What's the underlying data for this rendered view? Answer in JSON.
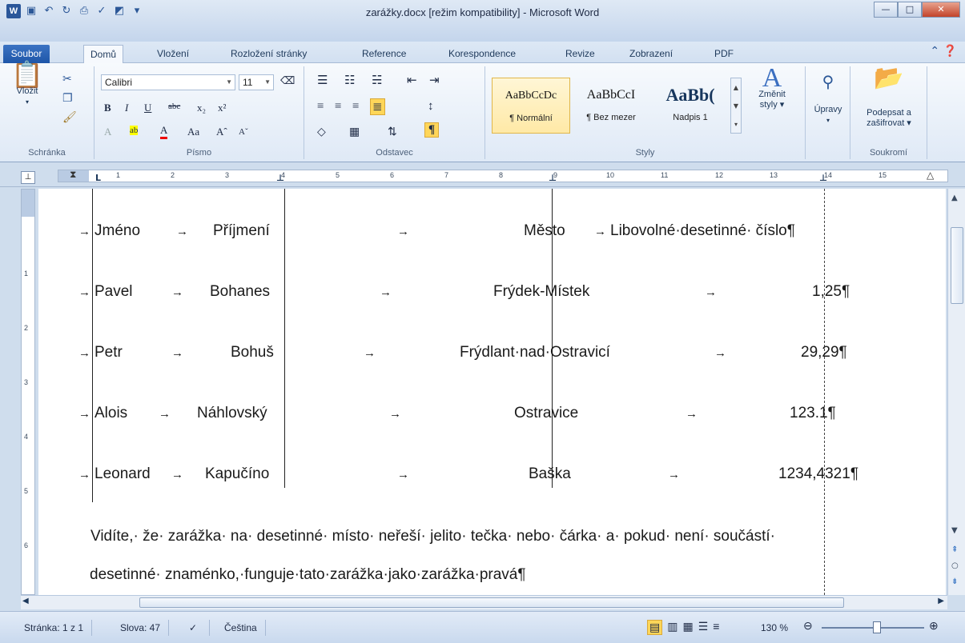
{
  "window": {
    "title": "zarážky.docx [režim kompatibility]  -  Microsoft Word",
    "app_badge": "W"
  },
  "tabs": [
    {
      "label": "Soubor"
    },
    {
      "label": "Domů"
    },
    {
      "label": "Vložení"
    },
    {
      "label": "Rozložení stránky"
    },
    {
      "label": "Reference"
    },
    {
      "label": "Korespondence"
    },
    {
      "label": "Revize"
    },
    {
      "label": "Zobrazení"
    },
    {
      "label": "PDF"
    }
  ],
  "ribbon": {
    "clipboard": {
      "paste_label": "Vložit",
      "group_label": "Schránka"
    },
    "font": {
      "font_name": "Calibri",
      "font_size": "11",
      "group_label": "Písmo"
    },
    "paragraph": {
      "group_label": "Odstavec"
    },
    "styles": {
      "items": [
        {
          "preview": "AaBbCcDc",
          "name": "¶ Normální"
        },
        {
          "preview": "AaBbCcI",
          "name": "¶ Bez mezer"
        },
        {
          "preview": "AaBb(",
          "name": "Nadpis 1"
        }
      ],
      "change_label_1": "Změnit",
      "change_label_2": "styly",
      "group_label": "Styly"
    },
    "editing": {
      "label": "Úpravy"
    },
    "private": {
      "sign_label_1": "Podepsat a",
      "sign_label_2": "zašifrovat",
      "group_label": "Soukromí"
    }
  },
  "ruler": {
    "numbers": [
      "1",
      "2",
      "3",
      "4",
      "5",
      "6",
      "7",
      "8",
      "9",
      "10",
      "11",
      "12",
      "13",
      "14",
      "15"
    ]
  },
  "vruler": {
    "numbers": [
      "1",
      "2",
      "3",
      "4",
      "5",
      "6"
    ]
  },
  "document": {
    "rows": [
      {
        "c1": "Jméno",
        "c2": "Příjmení",
        "c3": "Město",
        "c4": "Libovolné·desetinné· číslo¶"
      },
      {
        "c1": "Pavel",
        "c2": "Bohanes",
        "c3": "Frýdek-Místek",
        "c4": "1,25¶"
      },
      {
        "c1": "Petr",
        "c2": "Bohuš",
        "c3": "Frýdlant·nad·Ostravicí",
        "c4": "29,29¶"
      },
      {
        "c1": "Alois",
        "c2": "Náhlovský",
        "c3": "Ostravice",
        "c4": "123.1¶"
      },
      {
        "c1": "Leonard",
        "c2": "Kapučíno",
        "c3": "Baška",
        "c4": "1234,4321¶"
      }
    ],
    "para_line1": "Vidíte,· že· zarážka· na· desetinné· místo· neřeší· jelito· tečka· nebo· čárka· a· pokud· není· součástí·",
    "para_line2": "desetinné· znaménko,·funguje·tato·zarážka·jako·zarážka·pravá¶"
  },
  "status": {
    "page": "Stránka: 1 z 1",
    "words": "Slova: 47",
    "language": "Čeština",
    "zoom": "130 %"
  }
}
